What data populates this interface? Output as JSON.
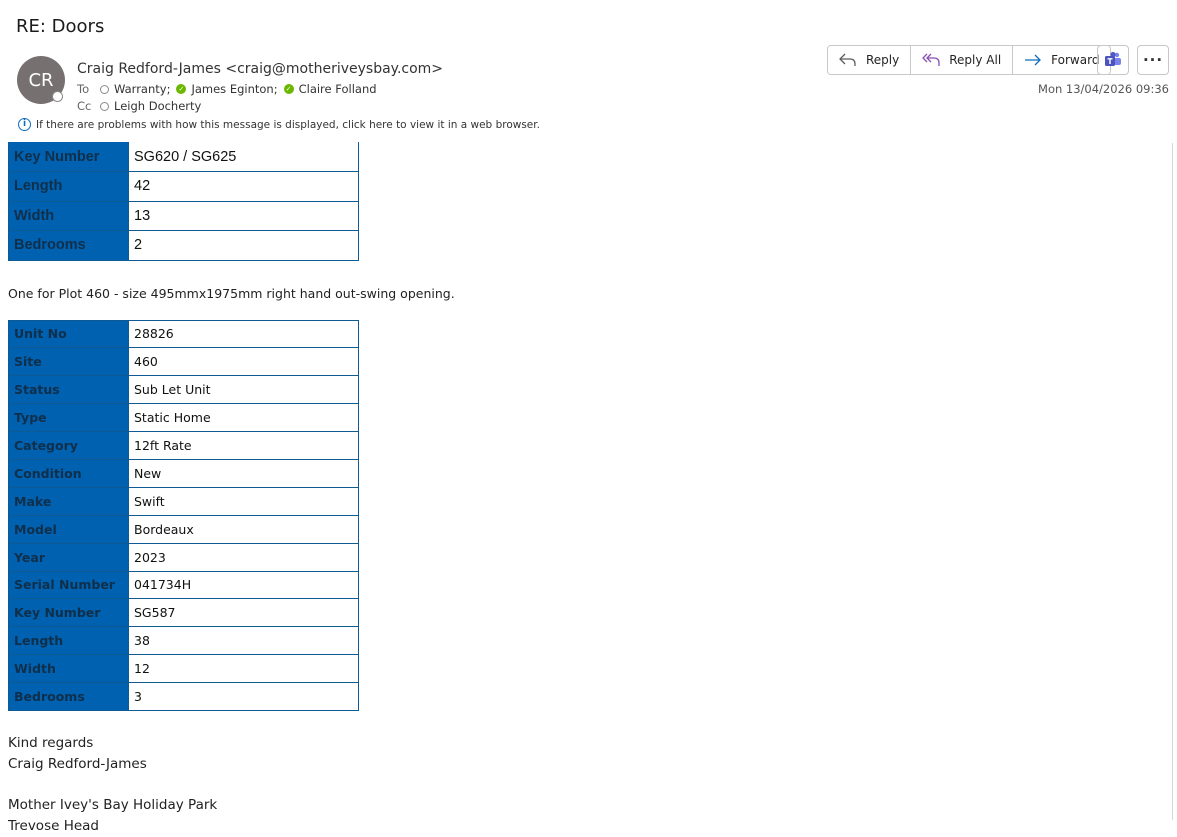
{
  "subject": "RE: Doors",
  "sender": {
    "initials": "CR",
    "display": "Craig Redford-James <craig@motheriveysbay.com>"
  },
  "to": {
    "label": "To",
    "recipients": [
      {
        "name": "Warranty;",
        "status": "unknown"
      },
      {
        "name": "James Eginton;",
        "status": "available"
      },
      {
        "name": "Claire Folland",
        "status": "available"
      }
    ]
  },
  "cc": {
    "label": "Cc",
    "recipients": [
      {
        "name": "Leigh Docherty",
        "status": "unknown"
      }
    ]
  },
  "info_bar": "If there are problems with how this message is displayed, click here to view it in a web browser.",
  "actions": {
    "reply": "Reply",
    "reply_all": "Reply All",
    "forward": "Forward",
    "more": "···"
  },
  "date": "Mon 13/04/2026 09:36",
  "table_top": [
    {
      "key": "Key Number",
      "value": "SG620 / SG625"
    },
    {
      "key": "Length",
      "value": "42"
    },
    {
      "key": "Width",
      "value": "13"
    },
    {
      "key": "Bedrooms",
      "value": "2"
    }
  ],
  "note": "One for Plot 460 - size 495mmx1975mm right hand out-swing opening.",
  "table_unit": [
    {
      "key": "Unit No",
      "value": "28826"
    },
    {
      "key": "Site",
      "value": "460"
    },
    {
      "key": "Status",
      "value": "Sub Let Unit"
    },
    {
      "key": "Type",
      "value": "Static Home"
    },
    {
      "key": "Category",
      "value": "12ft Rate"
    },
    {
      "key": "Condition",
      "value": "New"
    },
    {
      "key": "Make",
      "value": "Swift"
    },
    {
      "key": "Model",
      "value": "Bordeaux"
    },
    {
      "key": "Year",
      "value": "2023"
    },
    {
      "key": "Serial Number",
      "value": "041734H"
    },
    {
      "key": "Key Number",
      "value": "SG587"
    },
    {
      "key": "Length",
      "value": "38"
    },
    {
      "key": "Width",
      "value": "12"
    },
    {
      "key": "Bedrooms",
      "value": "3"
    }
  ],
  "signature": {
    "closing": "Kind regards",
    "name": "Craig Redford-James",
    "company": "Mother Ivey's Bay Holiday Park",
    "partial_line": "Trevose Head"
  },
  "colors": {
    "key_cell_bg": "#0061b0",
    "key_text": "#102f4a",
    "accent": "#0f6cbd",
    "available": "#6bb700"
  }
}
